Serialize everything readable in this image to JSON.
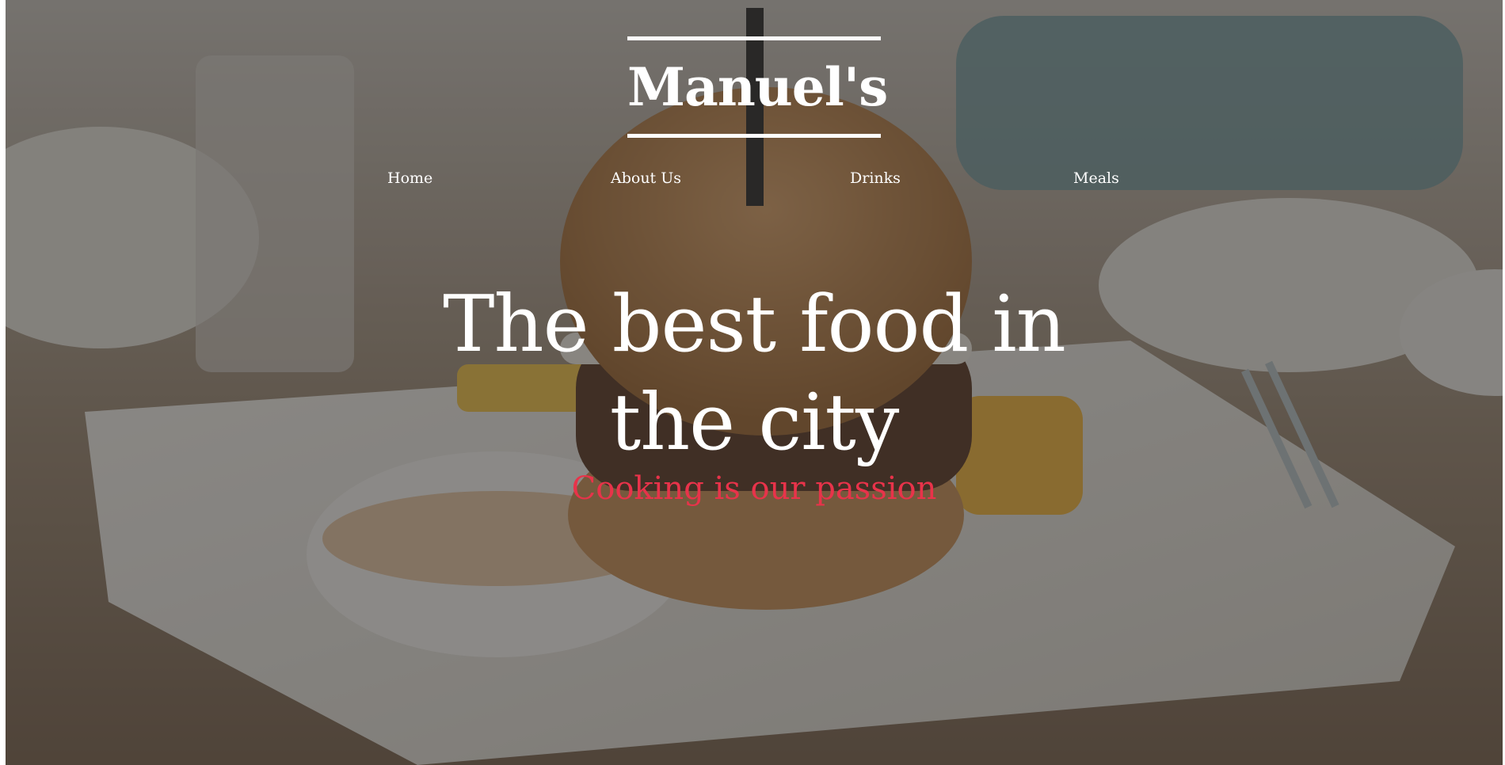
{
  "brand": {
    "name": "Manuel's"
  },
  "nav": {
    "items": [
      {
        "label": "Home"
      },
      {
        "label": "About Us"
      },
      {
        "label": "Drinks"
      },
      {
        "label": "Meals"
      }
    ]
  },
  "hero": {
    "headline": "The best food in the city",
    "tagline": "Cooking is our passion",
    "tagline_color": "#e8334a",
    "overlay_color": "#28262485",
    "background_image": "burger-on-plate-photo"
  }
}
